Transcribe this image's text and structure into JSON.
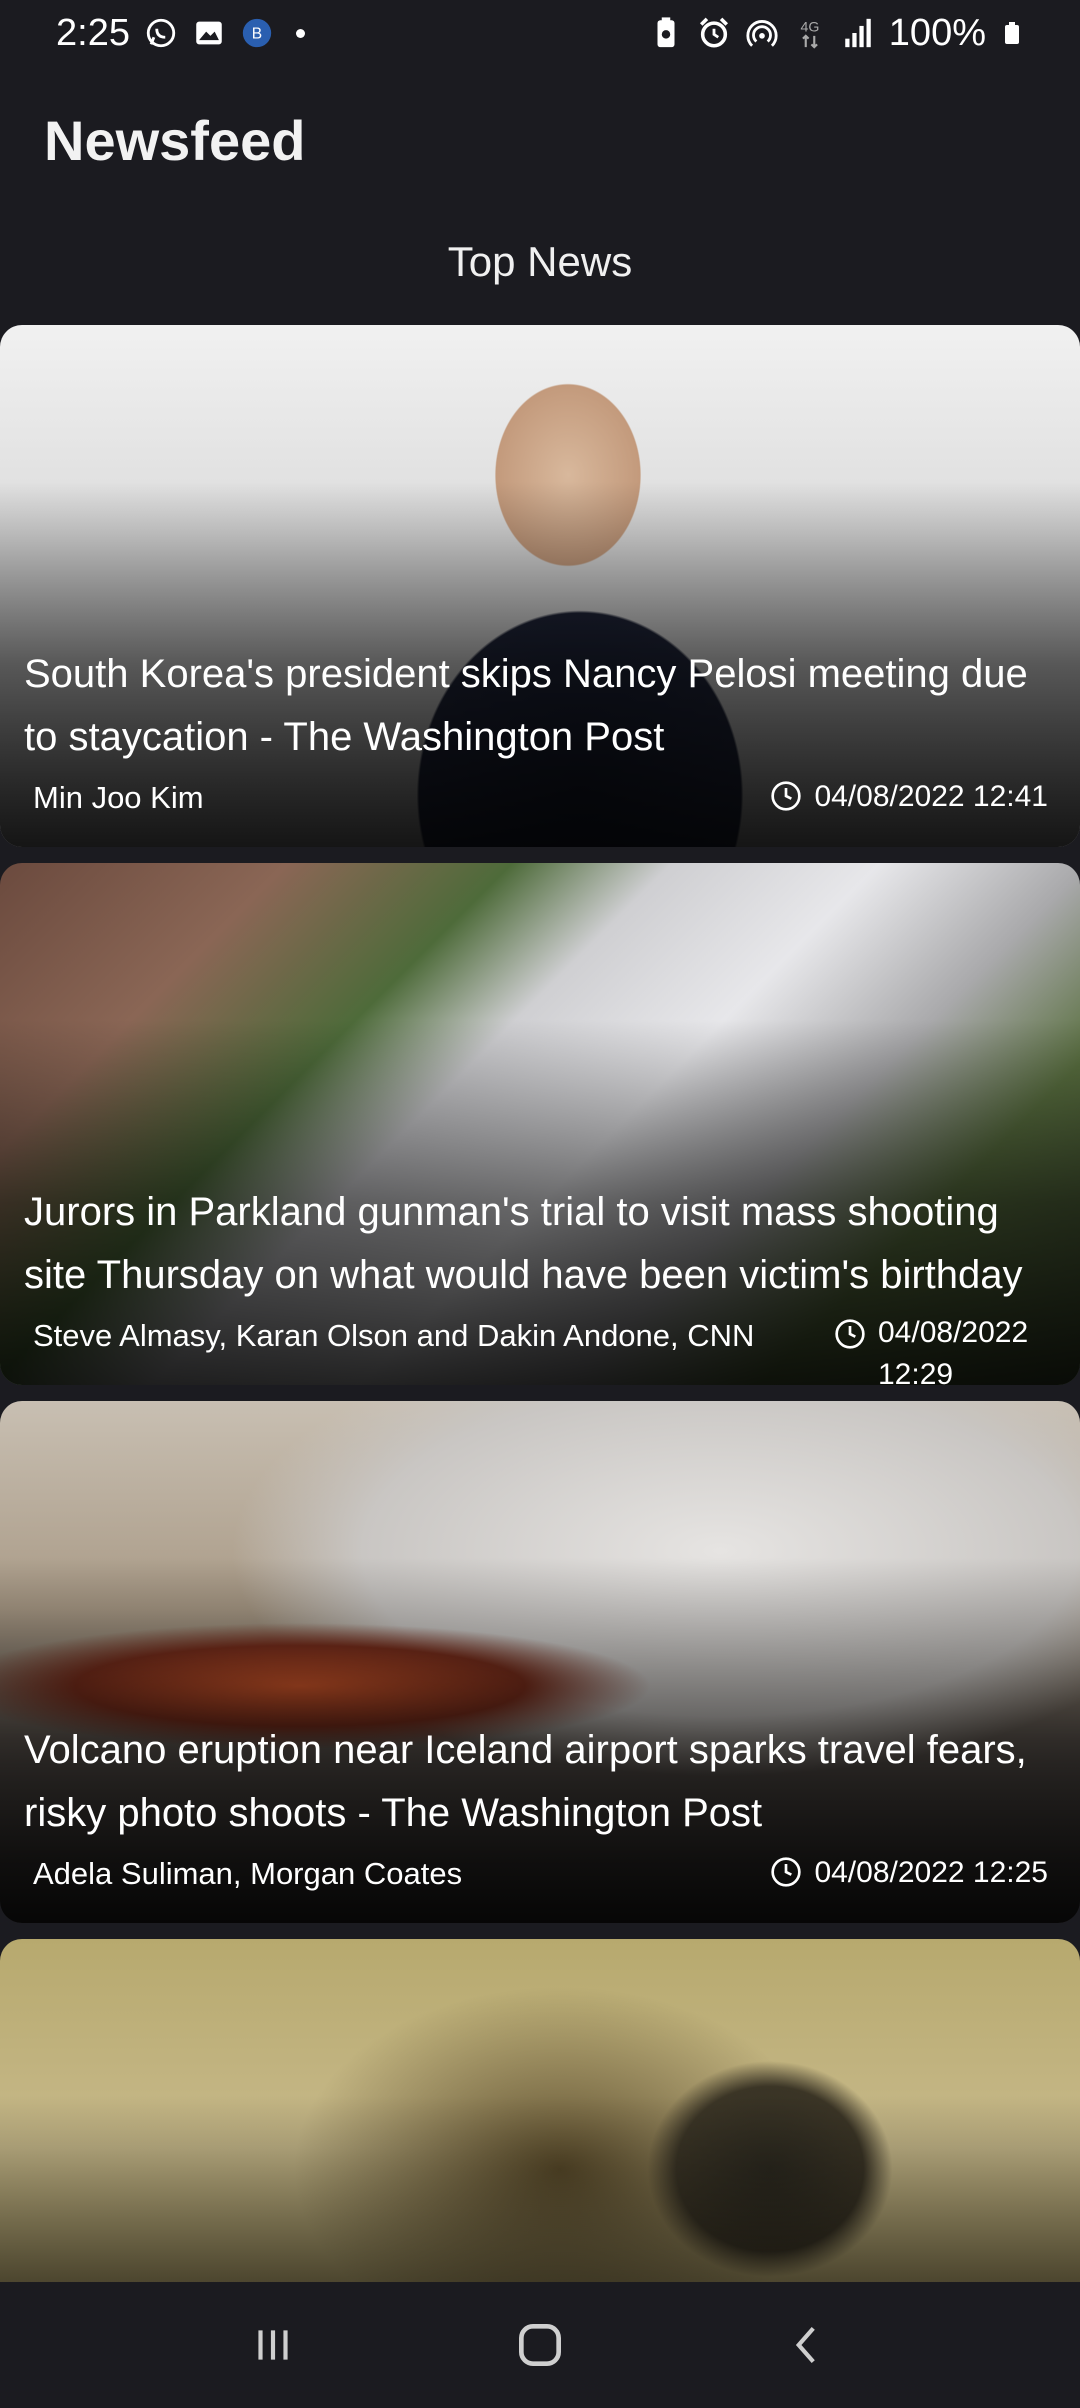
{
  "status_bar": {
    "time": "2:25",
    "battery": "100%",
    "network": "4G",
    "icons": [
      "whatsapp-icon",
      "gallery-icon",
      "app-icon",
      "dot",
      "battery-saver-icon",
      "alarm-icon",
      "hotspot-icon",
      "network-4g-icon",
      "signal-icon",
      "battery-icon"
    ]
  },
  "header": {
    "title": "Newsfeed"
  },
  "section": {
    "title": "Top News"
  },
  "articles": [
    {
      "headline": "South Korea's president skips Nancy Pelosi meeting due to staycation - The Washington Post",
      "author": "Min Joo Kim",
      "date": "04/08/2022 12:41"
    },
    {
      "headline": "Jurors in Parkland gunman's trial to visit mass shooting site Thursday on what would have been victim's birthday",
      "author": "Steve Almasy, Karan Olson and Dakin Andone, CNN",
      "date": "04/08/2022 12:29"
    },
    {
      "headline": "Volcano eruption near Iceland airport sparks travel fears, risky photo shoots - The Washington Post",
      "author": "Adela Suliman, Morgan Coates",
      "date": "04/08/2022 12:25"
    },
    {
      "headline": "",
      "author": "",
      "date": ""
    }
  ],
  "nav": {
    "icons": [
      "recent-apps-icon",
      "home-icon",
      "back-icon"
    ]
  }
}
